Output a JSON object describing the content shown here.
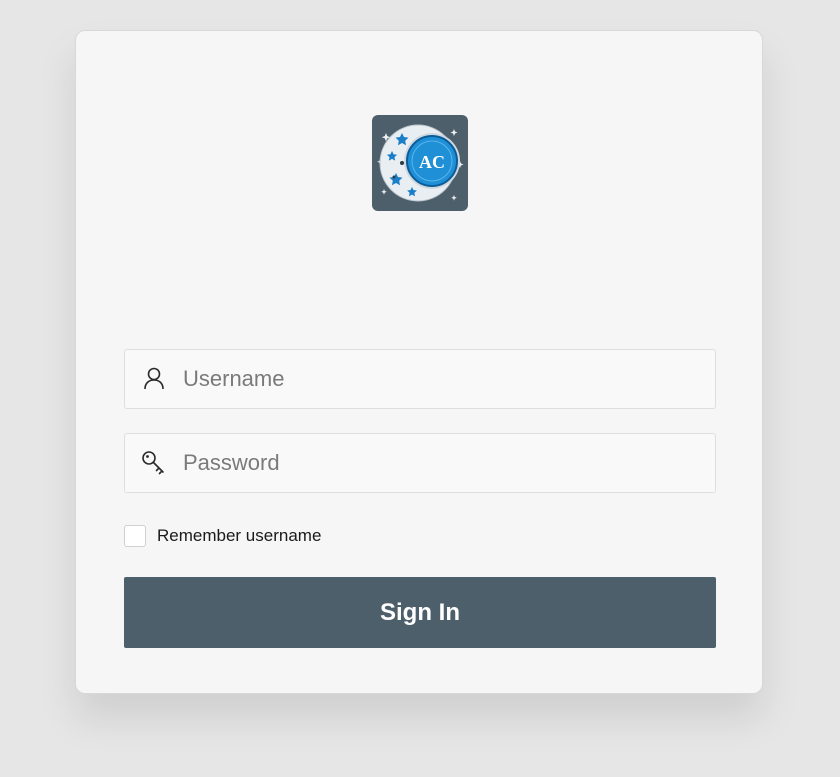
{
  "logo": {
    "text": "AC",
    "background": "#4e5f6c",
    "accent": "#1f8fd6"
  },
  "username": {
    "placeholder": "Username",
    "value": "",
    "icon": "user-icon"
  },
  "password": {
    "placeholder": "Password",
    "value": "",
    "icon": "key-icon"
  },
  "remember": {
    "label": "Remember username",
    "checked": false
  },
  "signin": {
    "label": "Sign In",
    "color": "#4e5f6c"
  }
}
